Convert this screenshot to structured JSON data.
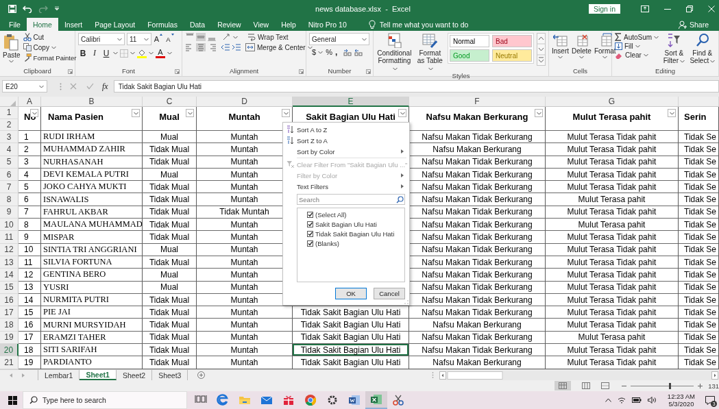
{
  "title_bar": {
    "title": "news database.xlsx  -  Excel",
    "sign_in": "Sign in"
  },
  "ribbon_tabs": [
    {
      "label": "File",
      "selected": false
    },
    {
      "label": "Home",
      "selected": true
    },
    {
      "label": "Insert",
      "selected": false
    },
    {
      "label": "Page Layout",
      "selected": false
    },
    {
      "label": "Formulas",
      "selected": false
    },
    {
      "label": "Data",
      "selected": false
    },
    {
      "label": "Review",
      "selected": false
    },
    {
      "label": "View",
      "selected": false
    },
    {
      "label": "Help",
      "selected": false
    },
    {
      "label": "Nitro Pro 10",
      "selected": false
    }
  ],
  "tell_me": "Tell me what you want to do",
  "share": "Share",
  "clipboard": {
    "paste": "Paste",
    "cut": "Cut",
    "copy": "Copy",
    "format_painter": "Format Painter",
    "label": "Clipboard"
  },
  "font": {
    "name": "Calibri",
    "size": "11",
    "grow": "A",
    "shrink": "A",
    "bold": "B",
    "italic": "I",
    "underline": "U",
    "font_color": "A",
    "label": "Font"
  },
  "alignment": {
    "vertical": [
      {
        "selected": false
      },
      {
        "selected": true
      },
      {
        "selected": false
      }
    ],
    "horizontal": [
      {
        "selected": false
      },
      {
        "selected": true
      },
      {
        "selected": false
      }
    ],
    "wrap_text": "Wrap Text",
    "merge": "Merge & Center",
    "label": "Alignment"
  },
  "number": {
    "format": "General",
    "currency": "$",
    "percent": "%",
    "comma": ",",
    "label": "Number"
  },
  "styles": {
    "conditional": "Conditional Formatting",
    "format_as_table": "Format as Table",
    "cell_styles": [
      {
        "label": "Normal",
        "color": "#ffffff"
      },
      {
        "label": "Bad",
        "color": "#ffc7ce"
      },
      {
        "label": "Good",
        "color": "#c6efce"
      },
      {
        "label": "Neutral",
        "color": "#ffeb9c"
      }
    ],
    "label": "Styles"
  },
  "cells": {
    "buttons": [
      "Insert",
      "Delete",
      "Format"
    ],
    "label": "Cells"
  },
  "editing": {
    "autosum": "AutoSum",
    "fill": "Fill",
    "clear": "Clear",
    "sort_filter": "Sort & Filter",
    "find_select": "Find & Select",
    "label": "Editing"
  },
  "formula_bar": {
    "name_box": "E20",
    "fx": "fx",
    "content": "Tidak Sakit Bagian Ulu Hati"
  },
  "columns": [
    {
      "letter": "A",
      "selected": false
    },
    {
      "letter": "B",
      "selected": false
    },
    {
      "letter": "C",
      "selected": false
    },
    {
      "letter": "D",
      "selected": false
    },
    {
      "letter": "E",
      "selected": true
    },
    {
      "letter": "F",
      "selected": false
    },
    {
      "letter": "G",
      "selected": false
    }
  ],
  "header_row": {
    "rows": [
      "1",
      "2"
    ],
    "cells": [
      "No",
      "Nama Pasien",
      "Mual",
      "Muntah",
      "Sakit Bagian Ulu Hati",
      "Nafsu Makan Berkurang",
      "Mulut Terasa pahit",
      "Serin"
    ]
  },
  "rows": [
    {
      "row": "3",
      "selected": false,
      "cells": [
        "1",
        "RUDI IRHAM",
        "Mual",
        "Muntah",
        null,
        "Nafsu Makan Tidak Berkurang",
        "Mulut Terasa Tidak pahit",
        "Tidak Se"
      ]
    },
    {
      "row": "4",
      "selected": false,
      "cells": [
        "2",
        "MUHAMMAD ZAHIR",
        "Tidak Mual",
        "Muntah",
        null,
        "Nafsu Makan Berkurang",
        "Mulut Terasa Tidak pahit",
        "Tidak Se"
      ]
    },
    {
      "row": "5",
      "selected": false,
      "cells": [
        "3",
        "NURHASANAH",
        "Tidak Mual",
        "Muntah",
        null,
        "Nafsu Makan Tidak Berkurang",
        "Mulut Terasa Tidak pahit",
        "Tidak Se"
      ]
    },
    {
      "row": "6",
      "selected": false,
      "cells": [
        "4",
        "DEVI KEMALA PUTRI",
        "Mual",
        "Muntah",
        null,
        "Nafsu Makan Tidak Berkurang",
        "Mulut Terasa Tidak pahit",
        "Tidak Se"
      ]
    },
    {
      "row": "7",
      "selected": false,
      "cells": [
        "5",
        "JOKO CAHYA MUKTI",
        "Tidak Mual",
        "Muntah",
        null,
        "Nafsu Makan Tidak Berkurang",
        "Mulut Terasa Tidak pahit",
        "Tidak Se"
      ]
    },
    {
      "row": "8",
      "selected": false,
      "cells": [
        "6",
        "ISNAWALIS",
        "Tidak Mual",
        "Muntah",
        null,
        "Nafsu Makan Tidak Berkurang",
        "Mulut Terasa pahit",
        "Tidak Se"
      ]
    },
    {
      "row": "9",
      "selected": false,
      "cells": [
        "7",
        "FAHRUL AKBAR",
        "Tidak Mual",
        "Tidak Muntah",
        null,
        "Nafsu Makan Tidak Berkurang",
        "Mulut Terasa Tidak pahit",
        "Tidak Se"
      ]
    },
    {
      "row": "10",
      "selected": false,
      "cells": [
        "8",
        "MAULANA MUHAMMAD",
        "Tidak Mual",
        "Muntah",
        null,
        "Nafsu Makan Tidak Berkurang",
        "Mulut Terasa pahit",
        "Tidak Se"
      ]
    },
    {
      "row": "11",
      "selected": false,
      "cells": [
        "9",
        "MISPAR",
        "Tidak Mual",
        "Muntah",
        null,
        "Nafsu Makan Tidak Berkurang",
        "Mulut Terasa Tidak pahit",
        "Tidak Se"
      ]
    },
    {
      "row": "12",
      "selected": false,
      "cells": [
        "10",
        "SINTIA TRI ANGGRIANI",
        "Mual",
        "Muntah",
        null,
        "Nafsu Makan Tidak Berkurang",
        "Mulut Terasa Tidak pahit",
        "Tidak Se"
      ]
    },
    {
      "row": "13",
      "selected": false,
      "cells": [
        "11",
        "SILVIA FORTUNA",
        "Tidak Mual",
        "Muntah",
        null,
        "Nafsu Makan Tidak Berkurang",
        "Mulut Terasa Tidak pahit",
        "Tidak Se"
      ]
    },
    {
      "row": "14",
      "selected": false,
      "cells": [
        "12",
        "GENTINA BERO",
        "Mual",
        "Muntah",
        null,
        "Nafsu Makan Tidak Berkurang",
        "Mulut Terasa Tidak pahit",
        "Tidak Se"
      ]
    },
    {
      "row": "15",
      "selected": false,
      "cells": [
        "13",
        "YUSRI",
        "Mual",
        "Muntah",
        null,
        "Nafsu Makan Tidak Berkurang",
        "Mulut Terasa Tidak pahit",
        "Tidak Se"
      ]
    },
    {
      "row": "16",
      "selected": false,
      "cells": [
        "14",
        "NURMITA PUTRI",
        "Tidak Mual",
        "Muntah",
        null,
        "Nafsu Makan Tidak Berkurang",
        "Mulut Terasa Tidak pahit",
        "Tidak Se"
      ]
    },
    {
      "row": "17",
      "selected": false,
      "cells": [
        "15",
        "PIE JAI",
        "Tidak Mual",
        "Muntah",
        "Tidak Sakit Bagian Ulu Hati",
        "Nafsu Makan Tidak Berkurang",
        "Mulut Terasa Tidak pahit",
        "Tidak Se"
      ]
    },
    {
      "row": "18",
      "selected": false,
      "cells": [
        "16",
        "MURNI MURSYIDAH",
        "Tidak Mual",
        "Muntah",
        "Tidak Sakit Bagian Ulu Hati",
        "Nafsu Makan Berkurang",
        "Mulut Terasa Tidak pahit",
        "Tidak Se"
      ]
    },
    {
      "row": "19",
      "selected": false,
      "cells": [
        "17",
        "ERAMZI TAHER",
        "Tidak Mual",
        "Muntah",
        "Tidak Sakit Bagian Ulu Hati",
        "Nafsu Makan Tidak Berkurang",
        "Mulut Terasa pahit",
        "Tidak Se"
      ]
    },
    {
      "row": "20",
      "selected": true,
      "cells": [
        "18",
        "SITI SARIFAH",
        "Tidak Mual",
        "Muntah",
        "Tidak Sakit Bagian Ulu Hati",
        "Nafsu Makan Tidak Berkurang",
        "Mulut Terasa Tidak pahit",
        "Tidak Se"
      ]
    },
    {
      "row": "21",
      "selected": false,
      "cells": [
        "19",
        "PARDIANTO",
        "Tidak Mual",
        "Muntah",
        "Tidak Sakit Bagian Ulu Hati",
        "Nafsu Makan Berkurang",
        "Mulut Terasa Tidak pahit",
        "Tidak Se"
      ]
    }
  ],
  "filter_menu": {
    "items": [
      {
        "label": "Sort A to Z",
        "kind": "sort-asc",
        "disabled": false,
        "submenu": false
      },
      {
        "label": "Sort Z to A",
        "kind": "sort-desc",
        "disabled": false,
        "submenu": false
      },
      {
        "label": "Sort by Color",
        "kind": "plain",
        "disabled": false,
        "submenu": true
      },
      {
        "label": "Clear Filter From \"Sakit Bagian Ulu ...\"",
        "kind": "clear",
        "disabled": true,
        "submenu": false
      },
      {
        "label": "Filter by Color",
        "kind": "plain",
        "disabled": true,
        "submenu": true
      },
      {
        "label": "Text Filters",
        "kind": "plain",
        "disabled": false,
        "submenu": true
      }
    ],
    "search": {
      "placeholder": "Search"
    },
    "values": [
      {
        "label": "(Select All)",
        "checked": true
      },
      {
        "label": "Sakit Bagian Ulu Hati",
        "checked": true
      },
      {
        "label": "Tidak Sakit Bagian Ulu Hati",
        "checked": true
      },
      {
        "label": "(Blanks)",
        "checked": true
      }
    ],
    "ok": "OK",
    "cancel": "Cancel"
  },
  "sheet_tabs": [
    {
      "label": "Lembar1",
      "selected": false
    },
    {
      "label": "Sheet1",
      "selected": true
    },
    {
      "label": "Sheet2",
      "selected": false
    },
    {
      "label": "Sheet3",
      "selected": false
    }
  ],
  "status_bar": {
    "zoom": {
      "level": 0.62,
      "reading": "131"
    }
  },
  "taskbar": {
    "search": {
      "placeholder": "Type here to search"
    },
    "time": "12:23 AM",
    "date": "5/3/2020",
    "notifications": "3"
  }
}
